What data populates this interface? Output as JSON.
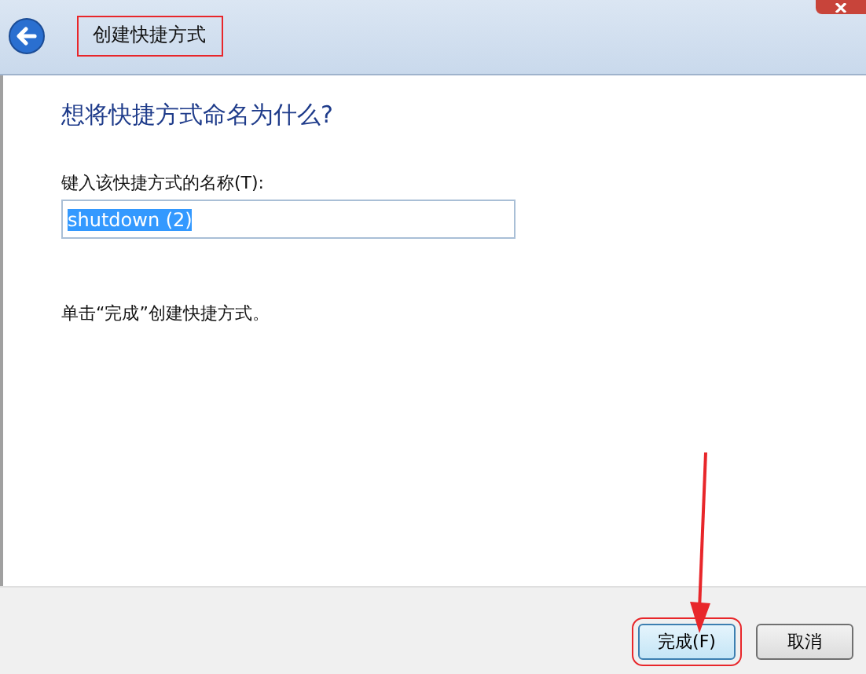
{
  "window": {
    "title": "创建快捷方式"
  },
  "heading": "想将快捷方式命名为什么?",
  "name_field": {
    "label": "键入该快捷方式的名称(T):",
    "value": "shutdown (2)",
    "selected": true
  },
  "instruction": "单击“完成”创建快捷方式。",
  "buttons": [
    {
      "label": "完成(F)",
      "kind": "default"
    },
    {
      "label": "取消",
      "kind": "normal"
    }
  ]
}
